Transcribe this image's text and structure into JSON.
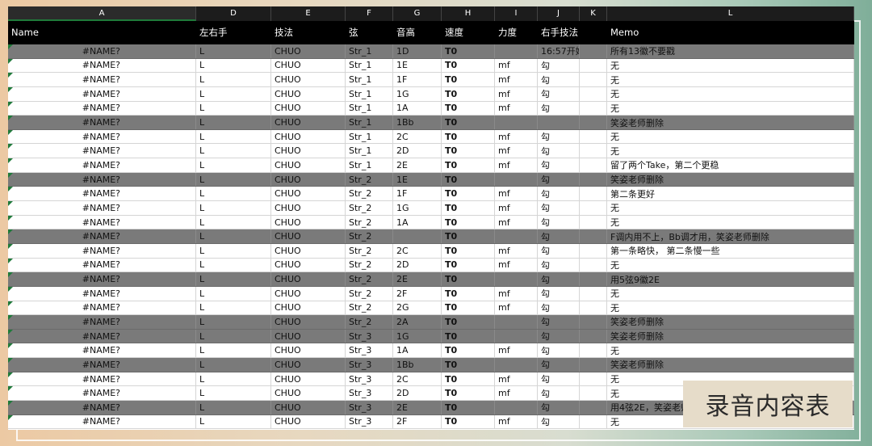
{
  "column_letters": [
    "A",
    "D",
    "E",
    "F",
    "G",
    "H",
    "I",
    "J",
    "K",
    "L"
  ],
  "selected_column": "A",
  "header": [
    "Name",
    "左右手",
    "技法",
    "弦",
    "音高",
    "速度",
    "力度",
    "右手技法",
    "",
    "Memo"
  ],
  "rows": [
    {
      "gray": true,
      "cells": [
        "#NAME?",
        "L",
        "CHUO",
        "Str_1",
        "1D",
        "T0",
        "",
        "16:57开始",
        "",
        "所有13徽不要戳"
      ]
    },
    {
      "gray": false,
      "cells": [
        "#NAME?",
        "L",
        "CHUO",
        "Str_1",
        "1E",
        "T0",
        "mf",
        "勾",
        "",
        "无"
      ]
    },
    {
      "gray": false,
      "cells": [
        "#NAME?",
        "L",
        "CHUO",
        "Str_1",
        "1F",
        "T0",
        "mf",
        "勾",
        "",
        "无"
      ]
    },
    {
      "gray": false,
      "cells": [
        "#NAME?",
        "L",
        "CHUO",
        "Str_1",
        "1G",
        "T0",
        "mf",
        "勾",
        "",
        "无"
      ]
    },
    {
      "gray": false,
      "cells": [
        "#NAME?",
        "L",
        "CHUO",
        "Str_1",
        "1A",
        "T0",
        "mf",
        "勾",
        "",
        "无"
      ]
    },
    {
      "gray": true,
      "cells": [
        "#NAME?",
        "L",
        "CHUO",
        "Str_1",
        "1Bb",
        "T0",
        "",
        "",
        "",
        "笑姿老师删除"
      ]
    },
    {
      "gray": false,
      "cells": [
        "#NAME?",
        "L",
        "CHUO",
        "Str_1",
        "2C",
        "T0",
        "mf",
        "勾",
        "",
        "无"
      ]
    },
    {
      "gray": false,
      "cells": [
        "#NAME?",
        "L",
        "CHUO",
        "Str_1",
        "2D",
        "T0",
        "mf",
        "勾",
        "",
        "无"
      ]
    },
    {
      "gray": false,
      "cells": [
        "#NAME?",
        "L",
        "CHUO",
        "Str_1",
        "2E",
        "T0",
        "mf",
        "勾",
        "",
        "留了两个Take，第二个更稳"
      ]
    },
    {
      "gray": true,
      "cells": [
        "#NAME?",
        "L",
        "CHUO",
        "Str_2",
        "1E",
        "T0",
        "",
        "勾",
        "",
        "笑姿老师删除"
      ]
    },
    {
      "gray": false,
      "cells": [
        "#NAME?",
        "L",
        "CHUO",
        "Str_2",
        "1F",
        "T0",
        "mf",
        "勾",
        "",
        "第二条更好"
      ]
    },
    {
      "gray": false,
      "cells": [
        "#NAME?",
        "L",
        "CHUO",
        "Str_2",
        "1G",
        "T0",
        "mf",
        "勾",
        "",
        "无"
      ]
    },
    {
      "gray": false,
      "cells": [
        "#NAME?",
        "L",
        "CHUO",
        "Str_2",
        "1A",
        "T0",
        "mf",
        "勾",
        "",
        "无"
      ]
    },
    {
      "gray": true,
      "cells": [
        "#NAME?",
        "L",
        "CHUO",
        "Str_2",
        "",
        "T0",
        "",
        "勾",
        "",
        "F调内用不上，Bb调才用，笑姿老师删除"
      ]
    },
    {
      "gray": false,
      "cells": [
        "#NAME?",
        "L",
        "CHUO",
        "Str_2",
        "2C",
        "T0",
        "mf",
        "勾",
        "",
        "第一条略快， 第二条慢一些"
      ]
    },
    {
      "gray": false,
      "cells": [
        "#NAME?",
        "L",
        "CHUO",
        "Str_2",
        "2D",
        "T0",
        "mf",
        "勾",
        "",
        "无"
      ]
    },
    {
      "gray": true,
      "cells": [
        "#NAME?",
        "L",
        "CHUO",
        "Str_2",
        "2E",
        "T0",
        "",
        "勾",
        "",
        "用5弦9徽2E"
      ]
    },
    {
      "gray": false,
      "cells": [
        "#NAME?",
        "L",
        "CHUO",
        "Str_2",
        "2F",
        "T0",
        "mf",
        "勾",
        "",
        "无"
      ]
    },
    {
      "gray": false,
      "cells": [
        "#NAME?",
        "L",
        "CHUO",
        "Str_2",
        "2G",
        "T0",
        "mf",
        "勾",
        "",
        "无"
      ]
    },
    {
      "gray": true,
      "cells": [
        "#NAME?",
        "L",
        "CHUO",
        "Str_2",
        "2A",
        "T0",
        "",
        "勾",
        "",
        "笑姿老师删除"
      ]
    },
    {
      "gray": true,
      "cells": [
        "#NAME?",
        "L",
        "CHUO",
        "Str_3",
        "1G",
        "T0",
        "",
        "勾",
        "",
        "笑姿老师删除"
      ]
    },
    {
      "gray": false,
      "cells": [
        "#NAME?",
        "L",
        "CHUO",
        "Str_3",
        "1A",
        "T0",
        "mf",
        "勾",
        "",
        "无"
      ]
    },
    {
      "gray": true,
      "cells": [
        "#NAME?",
        "L",
        "CHUO",
        "Str_3",
        "1Bb",
        "T0",
        "",
        "勾",
        "",
        "笑姿老师删除"
      ]
    },
    {
      "gray": false,
      "cells": [
        "#NAME?",
        "L",
        "CHUO",
        "Str_3",
        "2C",
        "T0",
        "mf",
        "勾",
        "",
        "无"
      ]
    },
    {
      "gray": false,
      "cells": [
        "#NAME?",
        "L",
        "CHUO",
        "Str_3",
        "2D",
        "T0",
        "mf",
        "勾",
        "",
        "无"
      ]
    },
    {
      "gray": true,
      "cells": [
        "#NAME?",
        "L",
        "CHUO",
        "Str_3",
        "2E",
        "T0",
        "",
        "勾",
        "",
        "用4弦2E，笑姿老师删除"
      ]
    },
    {
      "gray": false,
      "cells": [
        "#NAME?",
        "L",
        "CHUO",
        "Str_3",
        "2F",
        "T0",
        "mf",
        "勾",
        "",
        "无"
      ]
    }
  ],
  "overlay_title": "录音内容表"
}
